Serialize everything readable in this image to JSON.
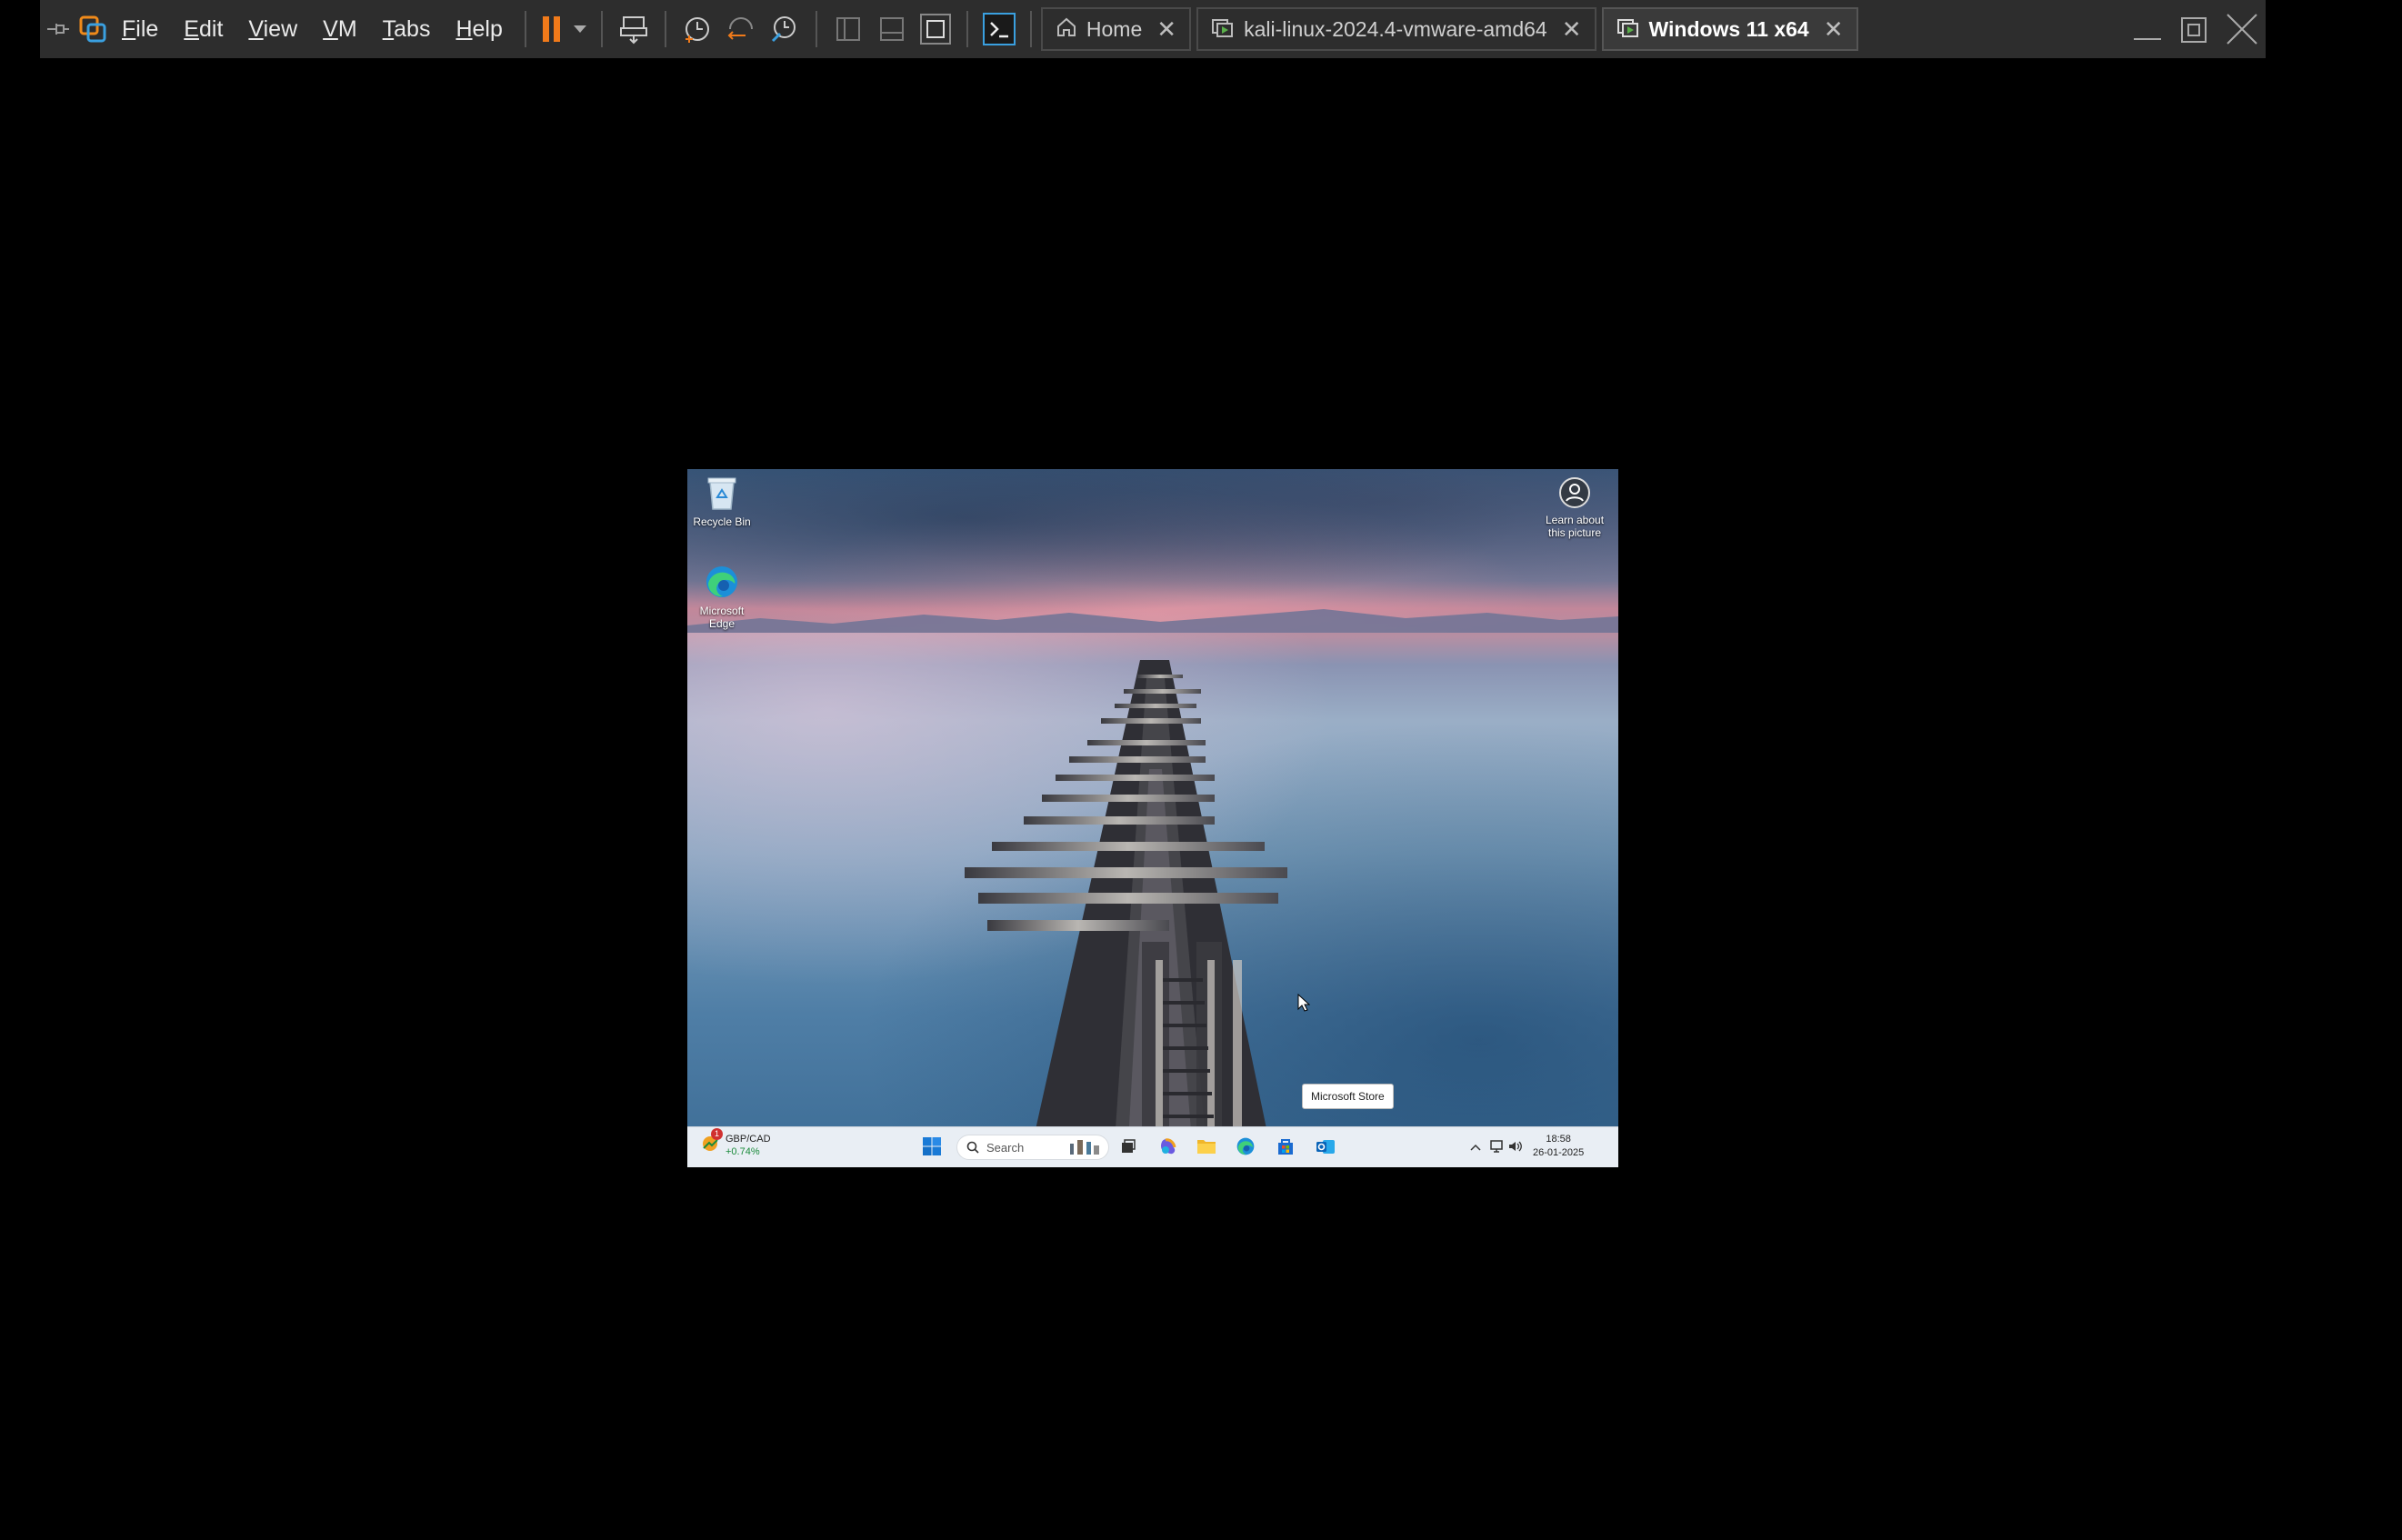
{
  "menu": [
    "File",
    "Edit",
    "View",
    "VM",
    "Tabs",
    "Help"
  ],
  "tabs": [
    {
      "label": "Home",
      "active": false
    },
    {
      "label": "kali-linux-2024.4-vmware-amd64",
      "active": false
    },
    {
      "label": "Windows 11 x64",
      "active": true
    }
  ],
  "colors": {
    "accent": "#f07a1a",
    "toolbar_bg": "#2d2d2d"
  },
  "desktop": {
    "icons": [
      {
        "label": "Recycle Bin",
        "icon": "recycle-bin-icon"
      },
      {
        "label": "Microsoft Edge",
        "icon": "edge-icon"
      }
    ],
    "spotlight_label": "Learn about this picture",
    "tooltip": "Microsoft Store"
  },
  "taskbar": {
    "widget": {
      "pair": "GBP/CAD",
      "change": "+0.74%",
      "badge": "1"
    },
    "search_placeholder": "Search",
    "apps": [
      "start-icon",
      "task-view-icon",
      "copilot-icon",
      "file-explorer-icon",
      "edge-icon",
      "microsoft-store-icon",
      "outlook-icon"
    ],
    "clock": {
      "time": "18:58",
      "date": "26-01-2025"
    }
  }
}
